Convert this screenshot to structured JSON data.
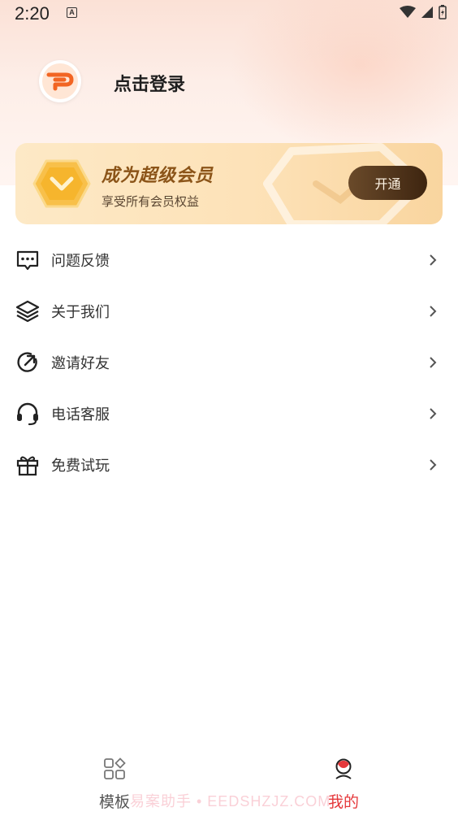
{
  "status_bar": {
    "time": "2:20",
    "notification": "A"
  },
  "profile": {
    "login_label": "点击登录",
    "avatar_letter": "P"
  },
  "vip": {
    "title": "成为超级会员",
    "subtitle": "享受所有会员权益",
    "button": "开通"
  },
  "menu": [
    {
      "label": "问题反馈",
      "icon": "feedback-icon"
    },
    {
      "label": "关于我们",
      "icon": "layers-icon"
    },
    {
      "label": "邀请好友",
      "icon": "share-icon"
    },
    {
      "label": "电话客服",
      "icon": "headset-icon"
    },
    {
      "label": "免费试玩",
      "icon": "gift-icon"
    }
  ],
  "bottom_nav": {
    "tabs": [
      {
        "label": "模板",
        "icon": "grid-icon",
        "active": false
      },
      {
        "label": "我的",
        "icon": "profile-icon",
        "active": true
      }
    ]
  },
  "watermark": "易案助手 • EEDSHZJZ.COM",
  "colors": {
    "accent": "#e5383b",
    "vip_text": "#8b5418",
    "brand_orange": "#f26522"
  }
}
